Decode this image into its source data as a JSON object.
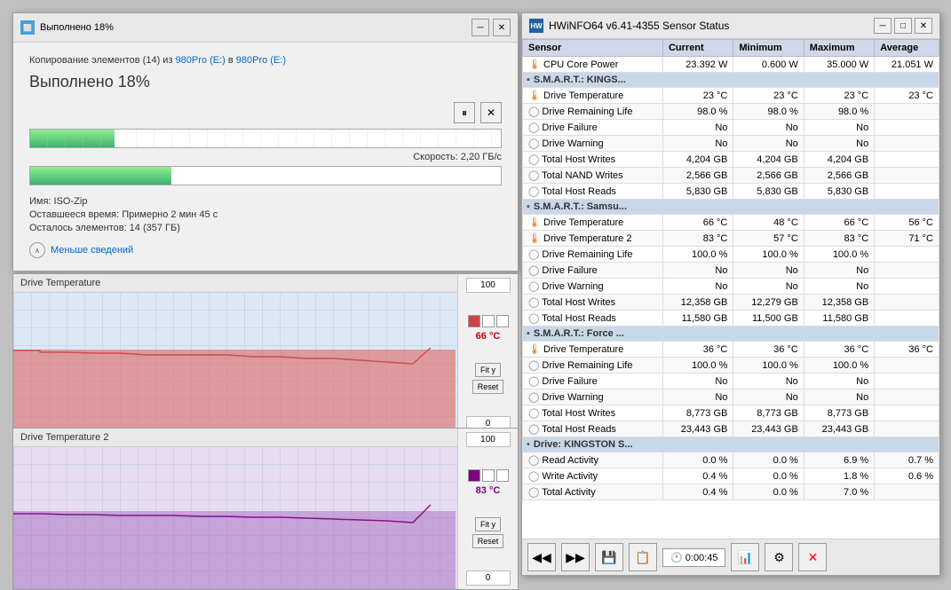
{
  "copyDialog": {
    "title": "Выполнено 18%",
    "infoLine": "Копирование элементов (14) из 980Pro (E:) в 980Pro (E:)",
    "sourceLink": "980Pro (E:)",
    "destLink": "980Pro (E:)",
    "progressTitle": "Выполнено 18%",
    "speed": "Скорость: 2,20 ГБ/с",
    "filename": "Имя: ISO-Zip",
    "timeRemaining": "Оставшееся время: Примерно 2 мин 45 с",
    "itemsLeft": "Осталось элементов: 14 (357 ГБ)",
    "lessDetails": "Меньше сведений",
    "pauseBtn": "⏸",
    "closeBtn": "✕"
  },
  "driveTemp1Panel": {
    "title": "Drive Temperature",
    "maxVal": "100",
    "currentTemp": "66 °C",
    "minVal": "0",
    "fitBtn": "Fit y",
    "resetBtn": "Reset"
  },
  "driveTemp2Panel": {
    "title": "Drive Temperature 2",
    "maxVal": "100",
    "currentTemp": "83 °C",
    "minVal": "0",
    "fitBtn": "Fit y",
    "resetBtn": "Reset"
  },
  "hwinfoPanel": {
    "title": "HWiNFO64 v6.41-4355 Sensor Status",
    "columns": [
      "Sensor",
      "Current",
      "Minimum",
      "Maximum",
      "Average"
    ],
    "rows": [
      {
        "type": "data",
        "icon": "thermo",
        "name": "CPU Core Power",
        "current": "23.392 W",
        "minimum": "0.600 W",
        "maximum": "35.000 W",
        "average": "21.051 W"
      },
      {
        "type": "group",
        "name": "S.M.A.R.T.: KINGS..."
      },
      {
        "type": "data",
        "icon": "thermo",
        "name": "Drive Temperature",
        "current": "23 °C",
        "minimum": "23 °C",
        "maximum": "23 °C",
        "average": "23 °C"
      },
      {
        "type": "data",
        "icon": "circle",
        "name": "Drive Remaining Life",
        "current": "98.0 %",
        "minimum": "98.0 %",
        "maximum": "98.0 %",
        "average": ""
      },
      {
        "type": "data",
        "icon": "circle",
        "name": "Drive Failure",
        "current": "No",
        "minimum": "No",
        "maximum": "No",
        "average": ""
      },
      {
        "type": "data",
        "icon": "circle",
        "name": "Drive Warning",
        "current": "No",
        "minimum": "No",
        "maximum": "No",
        "average": ""
      },
      {
        "type": "data",
        "icon": "circle",
        "name": "Total Host Writes",
        "current": "4,204 GB",
        "minimum": "4,204 GB",
        "maximum": "4,204 GB",
        "average": ""
      },
      {
        "type": "data",
        "icon": "circle",
        "name": "Total NAND Writes",
        "current": "2,566 GB",
        "minimum": "2,566 GB",
        "maximum": "2,566 GB",
        "average": ""
      },
      {
        "type": "data",
        "icon": "circle",
        "name": "Total Host Reads",
        "current": "5,830 GB",
        "minimum": "5,830 GB",
        "maximum": "5,830 GB",
        "average": ""
      },
      {
        "type": "group",
        "name": "S.M.A.R.T.: Samsu..."
      },
      {
        "type": "data",
        "icon": "thermo",
        "name": "Drive Temperature",
        "current": "66 °C",
        "minimum": "48 °C",
        "maximum": "66 °C",
        "average": "56 °C"
      },
      {
        "type": "data",
        "icon": "thermo",
        "name": "Drive Temperature 2",
        "current": "83 °C",
        "minimum": "57 °C",
        "maximum": "83 °C",
        "average": "71 °C"
      },
      {
        "type": "data",
        "icon": "circle",
        "name": "Drive Remaining Life",
        "current": "100.0 %",
        "minimum": "100.0 %",
        "maximum": "100.0 %",
        "average": ""
      },
      {
        "type": "data",
        "icon": "circle",
        "name": "Drive Failure",
        "current": "No",
        "minimum": "No",
        "maximum": "No",
        "average": ""
      },
      {
        "type": "data",
        "icon": "circle",
        "name": "Drive Warning",
        "current": "No",
        "minimum": "No",
        "maximum": "No",
        "average": ""
      },
      {
        "type": "data",
        "icon": "circle",
        "name": "Total Host Writes",
        "current": "12,358 GB",
        "minimum": "12,279 GB",
        "maximum": "12,358 GB",
        "average": ""
      },
      {
        "type": "data",
        "icon": "circle",
        "name": "Total Host Reads",
        "current": "11,580 GB",
        "minimum": "11,500 GB",
        "maximum": "11,580 GB",
        "average": ""
      },
      {
        "type": "group",
        "name": "S.M.A.R.T.: Force ..."
      },
      {
        "type": "data",
        "icon": "thermo",
        "name": "Drive Temperature",
        "current": "36 °C",
        "minimum": "36 °C",
        "maximum": "36 °C",
        "average": "36 °C"
      },
      {
        "type": "data",
        "icon": "circle",
        "name": "Drive Remaining Life",
        "current": "100.0 %",
        "minimum": "100.0 %",
        "maximum": "100.0 %",
        "average": ""
      },
      {
        "type": "data",
        "icon": "circle",
        "name": "Drive Failure",
        "current": "No",
        "minimum": "No",
        "maximum": "No",
        "average": ""
      },
      {
        "type": "data",
        "icon": "circle",
        "name": "Drive Warning",
        "current": "No",
        "minimum": "No",
        "maximum": "No",
        "average": ""
      },
      {
        "type": "data",
        "icon": "circle",
        "name": "Total Host Writes",
        "current": "8,773 GB",
        "minimum": "8,773 GB",
        "maximum": "8,773 GB",
        "average": ""
      },
      {
        "type": "data",
        "icon": "circle",
        "name": "Total Host Reads",
        "current": "23,443 GB",
        "minimum": "23,443 GB",
        "maximum": "23,443 GB",
        "average": ""
      },
      {
        "type": "group",
        "name": "Drive: KINGSTON S..."
      },
      {
        "type": "data",
        "icon": "circle",
        "name": "Read Activity",
        "current": "0.0 %",
        "minimum": "0.0 %",
        "maximum": "6.9 %",
        "average": "0.7 %"
      },
      {
        "type": "data",
        "icon": "circle",
        "name": "Write Activity",
        "current": "0.4 %",
        "minimum": "0.0 %",
        "maximum": "1.8 %",
        "average": "0.6 %"
      },
      {
        "type": "data",
        "icon": "circle",
        "name": "Total Activity",
        "current": "0.4 %",
        "minimum": "0.0 %",
        "maximum": "7.0 %",
        "average": ""
      }
    ],
    "bottomTime": "0:00:45",
    "bottomBtns": [
      "◀◀",
      "▶▶",
      "💾",
      "📋",
      "🕐",
      "📊",
      "⚙",
      "✕"
    ]
  }
}
